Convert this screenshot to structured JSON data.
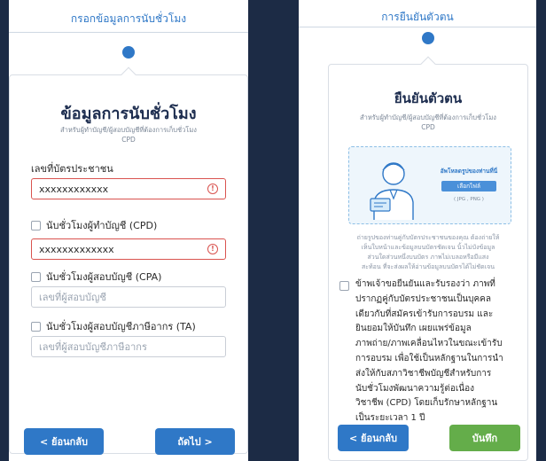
{
  "form_screen": {
    "step_title": "กรอกข้อมูลการนับชั่วโมง",
    "card_title": "ข้อมูลการนับชั่วโมง",
    "card_subtitle_1": "สำหรับผู้ทำบัญชี/ผู้สอบบัญชีที่ต้องการเก็บชั่วโมง",
    "card_subtitle_2": "CPD",
    "id_label": "เลขที่บัตรประชาชน",
    "id_value": "xxxxxxxxxxxx",
    "cpd_label": "นับชั่วโมงผู้ทำบัญชี (CPD)",
    "cpd_value": "xxxxxxxxxxxxx",
    "cpa_label": "นับชั่วโมงผู้สอบบัญชี (CPA)",
    "cpa_placeholder": "เลขที่ผู้สอบบัญชี",
    "ta_label": "นับชั่วโมงผู้สอบบัญชีภาษีอากร (TA)",
    "ta_placeholder": "เลขที่ผู้สอบบัญชีภาษีอากร",
    "back_button": "< ย้อนกลับ",
    "next_button": "ถัดไป >",
    "error_icon": "!"
  },
  "verify_screen": {
    "step_title": "การยืนยันตัวตน",
    "card_title": "ยืนยันตัวตน",
    "card_subtitle_1": "สำหรับผู้ทำบัญชี/ผู้สอบบัญชีที่ต้องการเก็บชั่วโมง",
    "card_subtitle_2": "CPD",
    "upload_title": "อัพโหลดรูปของท่านที่นี่",
    "choose_file_button": "เลือกไฟล์",
    "file_types": "( JPG , PNG )",
    "description": [
      "ถ่ายรูปของท่านคู่กับบัตรประชาชนของคุณ ต้องถ่ายให้",
      "เห็นใบหน้าและข้อมูลบนบัตรชัดเจน นิ้วไม่บังข้อมูล",
      "ส่วนใดส่วนหนึ่งบนบัตร ภาพไม่เบลอหรือมีแสง",
      "สะท้อน ที่จะส่งผลให้อ่านข้อมูลบนบัตรได้ไม่ชัดเจน"
    ],
    "consent_lines": [
      "ข้าพเจ้าขอยืนยันและรับรองว่า ภาพที่",
      "ปรากฏคู่กับบัตรประชาชนเป็นบุคคล",
      "เดียวกับที่สมัครเข้ารับการอบรม และ",
      "ยินยอมให้บันทึก เผยแพร่ข้อมูล",
      "ภาพถ่าย/ภาพเคลื่อนไหวในขณะเข้ารับ",
      "การอบรม เพื่อใช้เป็นหลักฐานในการนำ",
      "ส่งให้กับสภาวิชาชีพบัญชีสำหรับการ",
      "นับชั่วโมงพัฒนาความรู้ต่อเนื่อง",
      "วิชาชีพ (CPD) โดยเก็บรักษาหลักฐาน",
      "เป็นระยะเวลา 1 ปี"
    ],
    "back_button": "< ย้อนกลับ",
    "save_button": "บันทึก"
  },
  "colors": {
    "background": "#1c2b45",
    "primary": "#2f78c7",
    "success": "#64ad4a",
    "error": "#d9534f"
  }
}
